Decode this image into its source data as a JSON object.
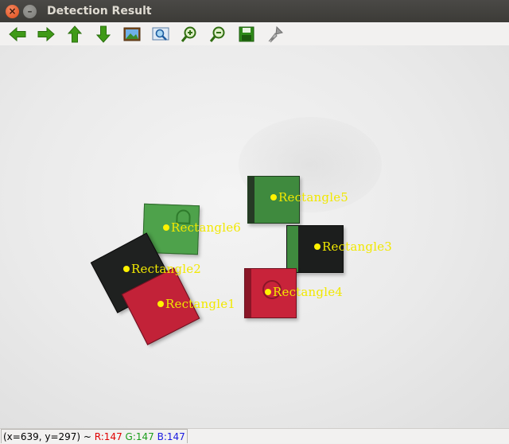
{
  "window": {
    "title": "Detection Result"
  },
  "toolbar": {
    "buttons": [
      {
        "icon": "arrow-left-icon"
      },
      {
        "icon": "arrow-right-icon"
      },
      {
        "icon": "arrow-up-icon"
      },
      {
        "icon": "arrow-down-icon"
      },
      {
        "icon": "image-icon"
      },
      {
        "icon": "zoom-fit-icon"
      },
      {
        "icon": "zoom-in-icon"
      },
      {
        "icon": "zoom-out-icon"
      },
      {
        "icon": "save-icon"
      },
      {
        "icon": "properties-icon"
      }
    ]
  },
  "detections": [
    {
      "label": "Rectangle1",
      "color": "#c22238"
    },
    {
      "label": "Rectangle2",
      "color": "#1f2120"
    },
    {
      "label": "Rectangle3",
      "color": "#1c1e1d"
    },
    {
      "label": "Rectangle4",
      "color": "#c8233a"
    },
    {
      "label": "Rectangle5",
      "color": "#3f8a3e"
    },
    {
      "label": "Rectangle6",
      "color": "#4ea24b"
    }
  ],
  "status": {
    "coords": "(x=639, y=297) ~ ",
    "r": "R:147",
    "g": "G:147",
    "b": "B:147"
  },
  "colors": {
    "label_color": "#f1e800"
  }
}
